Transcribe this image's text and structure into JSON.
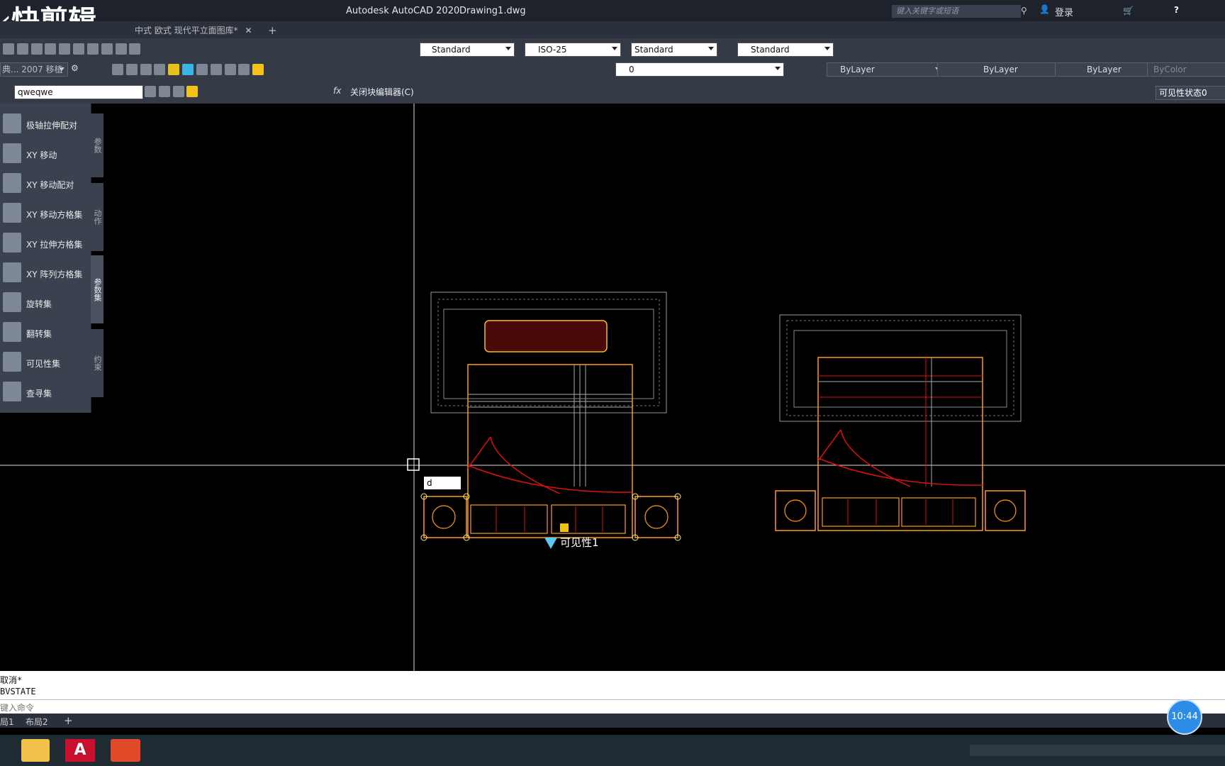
{
  "brand": "快剪辑",
  "window": {
    "app_title": "Autodesk AutoCAD 2020",
    "file": "Drawing1.dwg"
  },
  "tabs": [
    {
      "label": "中式 欧式 现代平立面图库*"
    },
    {
      "label": "+"
    }
  ],
  "header": {
    "search_placeholder": "键入关键字或短语",
    "login": "登录"
  },
  "toolbar1": {
    "text_style": "Standard",
    "dim_style": "ISO-25",
    "table_style": "Standard",
    "multileader_style": "Standard"
  },
  "toolbar2": {
    "workspace": "典... 2007 移植",
    "layer": "0",
    "color": "ByLayer",
    "linetype": "ByLayer",
    "lineweight": "ByLayer",
    "plotstyle": "ByColor"
  },
  "block_editor": {
    "block_name": "qweqwe",
    "close_label": "关闭块编辑器(C)",
    "visibility_state": "可见性状态0"
  },
  "palette": {
    "items": [
      {
        "label": "极轴拉伸配对"
      },
      {
        "label": "XY 移动"
      },
      {
        "label": "XY 移动配对"
      },
      {
        "label": "XY 移动方格集"
      },
      {
        "label": "XY 拉伸方格集"
      },
      {
        "label": "XY 阵列方格集"
      },
      {
        "label": "旋转集"
      },
      {
        "label": "翻转集"
      },
      {
        "label": "可见性集"
      },
      {
        "label": "查寻集"
      }
    ],
    "side_tabs": [
      "参数",
      "动作",
      "参数集",
      "约束"
    ]
  },
  "drawing": {
    "dyn_input": "d",
    "visibility_label": "可见性1"
  },
  "command": {
    "history": [
      "取消*",
      "BVSTATE"
    ],
    "prompt_placeholder": "键入命令"
  },
  "layouts": [
    "局1",
    "布局2",
    "+"
  ],
  "clock": "10:44",
  "colors": {
    "accent": "#2d8de6",
    "bed_outline": "#ff9b1a",
    "cushion_red": "#c81010",
    "grip": "#f5f37a"
  }
}
